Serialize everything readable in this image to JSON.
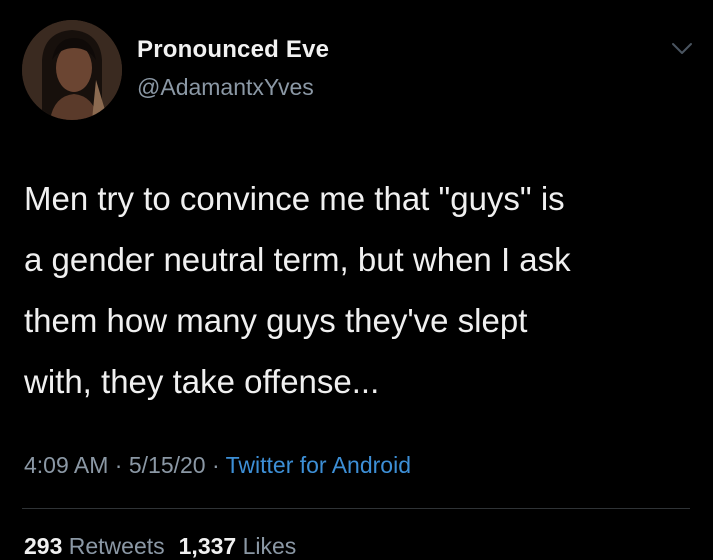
{
  "user": {
    "display_name": "Pronounced Eve",
    "handle": "@AdamantxYves"
  },
  "tweet": {
    "text": "Men try to convince me that \"guys\" is\na gender neutral term, but when I ask\nthem how many guys they've slept\nwith, they take offense..."
  },
  "meta": {
    "time": "4:09 AM",
    "sep1": " · ",
    "date": "5/15/20",
    "sep2": " · ",
    "source": "Twitter for Android"
  },
  "stats": {
    "retweets_count": "293",
    "retweets_label": " Retweets",
    "likes_count": "1,337",
    "likes_label": " Likes"
  },
  "icons": {
    "avatar": "avatar",
    "chevron": "chevron-down-icon"
  },
  "colors": {
    "background": "#000000",
    "secondary_text": "#8b98a5",
    "link": "#3d8fd6"
  }
}
